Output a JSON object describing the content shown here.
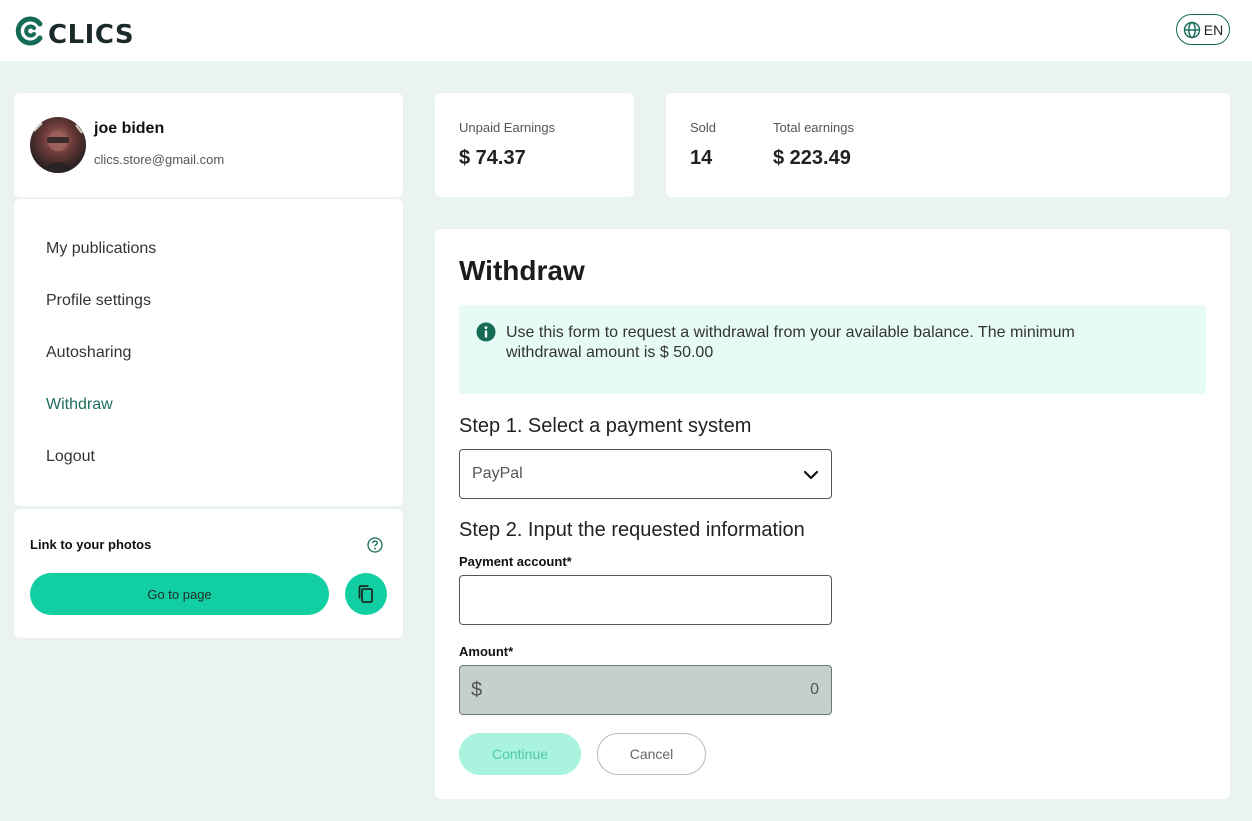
{
  "brand": {
    "name": "CLICS",
    "accent": "#12cfa3",
    "dark_green": "#146b56"
  },
  "header": {
    "language": "EN"
  },
  "profile": {
    "name": "joe biden",
    "email": "clics.store@gmail.com"
  },
  "sidebar": {
    "items": [
      {
        "label": "My publications",
        "active": false
      },
      {
        "label": "Profile settings",
        "active": false
      },
      {
        "label": "Autosharing",
        "active": false
      },
      {
        "label": "Withdraw",
        "active": true
      },
      {
        "label": "Logout",
        "active": false
      }
    ]
  },
  "photo_link": {
    "title": "Link to your photos",
    "button_label": "Go to page"
  },
  "stats": {
    "unpaid_label": "Unpaid Earnings",
    "unpaid_value": "$ 74.37",
    "sold_label": "Sold",
    "sold_value": "14",
    "total_label": "Total earnings",
    "total_value": "$ 223.49"
  },
  "withdraw": {
    "title": "Withdraw",
    "info": "Use this form to request a withdrawal from your available balance. The minimum withdrawal amount is $ 50.00",
    "step1": "Step 1. Select a payment system",
    "payment_system": "PayPal",
    "step2": "Step 2. Input the requested information",
    "account_label": "Payment account*",
    "account_value": "",
    "amount_label": "Amount*",
    "currency": "$",
    "amount_value": "0",
    "continue_label": "Continue",
    "cancel_label": "Cancel"
  }
}
